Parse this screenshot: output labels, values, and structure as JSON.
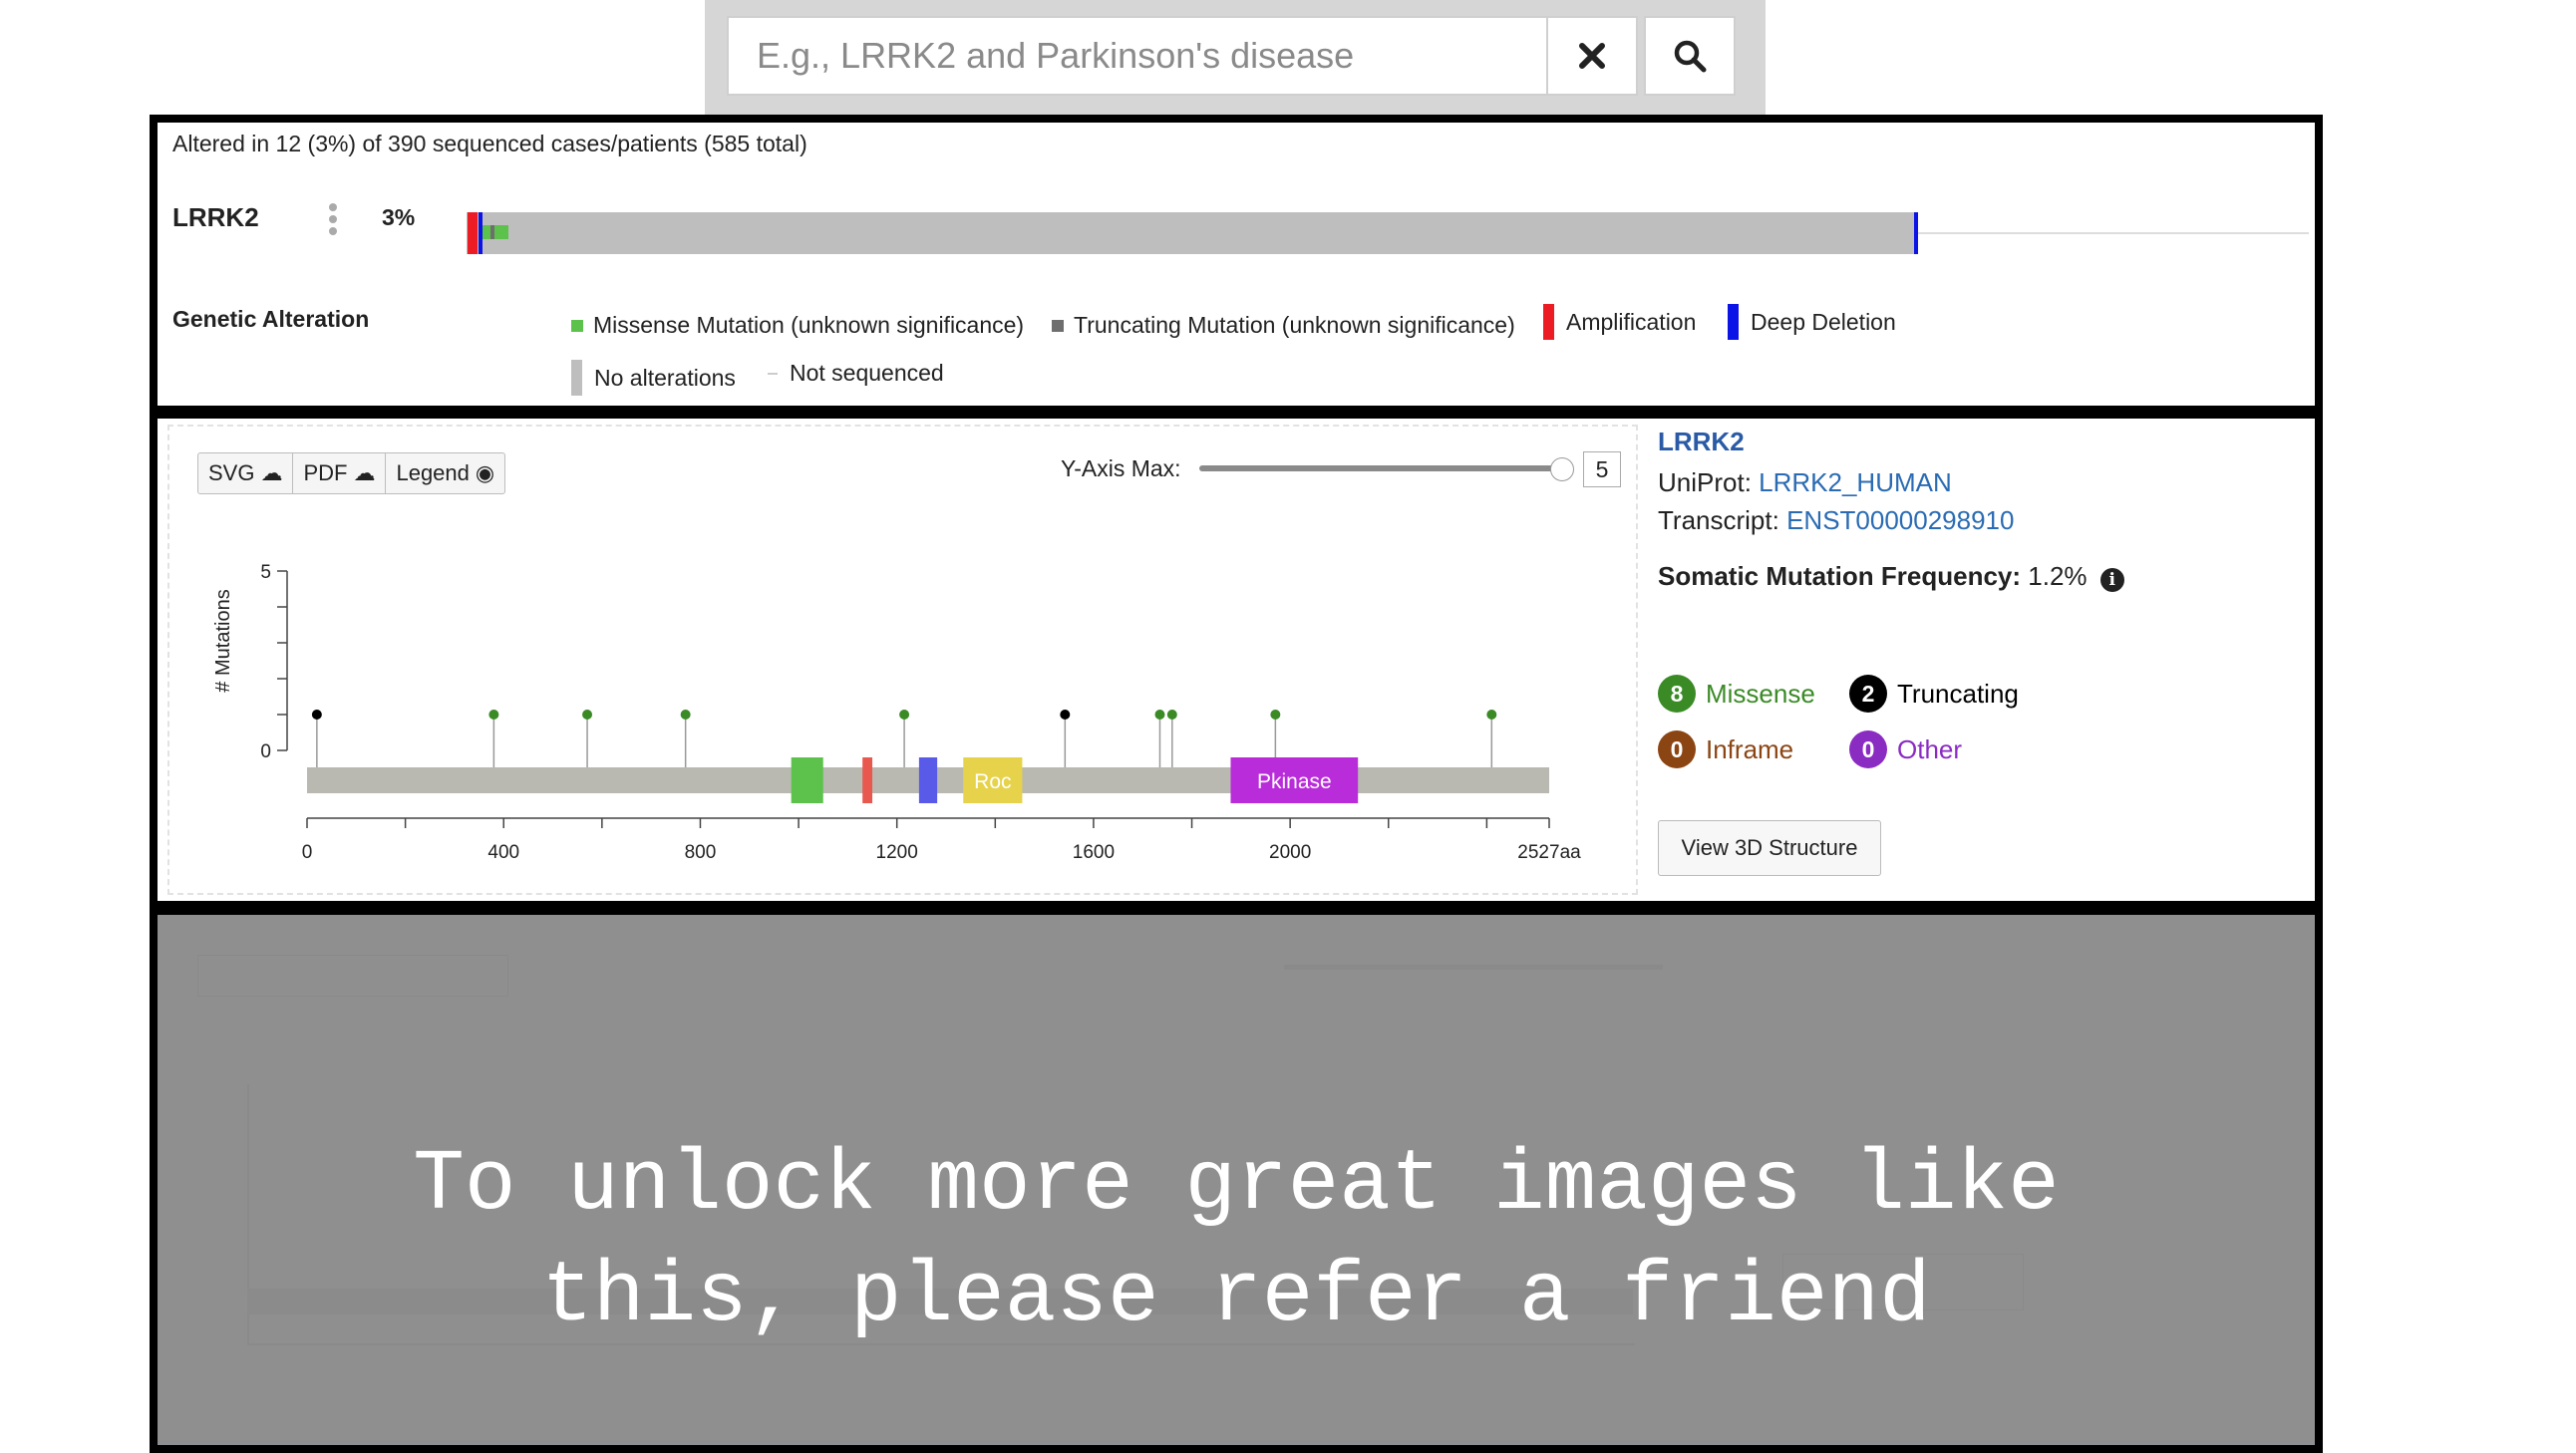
{
  "search": {
    "placeholder": "E.g., LRRK2 and Parkinson's disease",
    "clear_icon": "close-icon",
    "search_icon": "search-icon"
  },
  "oncoprint": {
    "summary": "Altered in 12 (3%) of 390 sequenced cases/patients (585 total)",
    "gene": "LRRK2",
    "percent": "3%",
    "altered_fraction": 0.03,
    "legend_title": "Genetic Alteration",
    "legend": [
      {
        "label": "Missense Mutation (unknown significance)",
        "color": "#5dc24b"
      },
      {
        "label": "Truncating Mutation (unknown significance)",
        "color": "#6e6e6e"
      },
      {
        "label": "Amplification",
        "color": "#ec1c24"
      },
      {
        "label": "Deep Deletion",
        "color": "#0c13e6"
      },
      {
        "label": "No alterations",
        "color": "#bebebe"
      },
      {
        "label": "Not sequenced",
        "color": "#dddddd"
      }
    ]
  },
  "mutation_panel": {
    "buttons": {
      "svg": "SVG",
      "pdf": "PDF",
      "legend": "Legend"
    },
    "y_axis_max_label": "Y-Axis Max:",
    "y_axis_max_value": "5",
    "gene_title": "LRRK2",
    "uniprot_label": "UniProt:",
    "uniprot_id": "LRRK2_HUMAN",
    "transcript_label": "Transcript:",
    "transcript_id": "ENST00000298910",
    "freq_label": "Somatic Mutation Frequency:",
    "freq_value": "1.2%",
    "types": [
      {
        "count": "8",
        "label": "Missense",
        "color": "#3a8a25"
      },
      {
        "count": "2",
        "label": "Truncating",
        "color": "#000000"
      },
      {
        "count": "0",
        "label": "Inframe",
        "color": "#8b4513"
      },
      {
        "count": "0",
        "label": "Other",
        "color": "#8a2bc2"
      }
    ],
    "view_3d_label": "View 3D Structure"
  },
  "chart_data": {
    "type": "lollipop",
    "ylabel": "# Mutations",
    "ylim": [
      0,
      5
    ],
    "yticks": [
      "0",
      "5"
    ],
    "xlim": [
      0,
      2527
    ],
    "xticks": [
      "0",
      "400",
      "800",
      "1200",
      "1600",
      "2000",
      "2527aa"
    ],
    "xtick_values": [
      0,
      400,
      800,
      1200,
      1600,
      2000,
      2527
    ],
    "lollipops": [
      {
        "position": 20,
        "count": 1,
        "type": "Truncating",
        "color": "#000000"
      },
      {
        "position": 380,
        "count": 1,
        "type": "Missense",
        "color": "#3a8a25"
      },
      {
        "position": 570,
        "count": 1,
        "type": "Missense",
        "color": "#3a8a25"
      },
      {
        "position": 770,
        "count": 1,
        "type": "Missense",
        "color": "#3a8a25"
      },
      {
        "position": 1215,
        "count": 1,
        "type": "Missense",
        "color": "#3a8a25"
      },
      {
        "position": 1542,
        "count": 1,
        "type": "Truncating",
        "color": "#000000"
      },
      {
        "position": 1735,
        "count": 1,
        "type": "Missense",
        "color": "#3a8a25"
      },
      {
        "position": 1760,
        "count": 1,
        "type": "Missense",
        "color": "#3a8a25"
      },
      {
        "position": 1970,
        "count": 1,
        "type": "Missense",
        "color": "#3a8a25"
      },
      {
        "position": 2410,
        "count": 1,
        "type": "Missense",
        "color": "#3a8a25"
      }
    ],
    "domains": [
      {
        "start": 985,
        "end": 1050,
        "label": "",
        "color": "#5dc24b"
      },
      {
        "start": 1130,
        "end": 1150,
        "label": "",
        "color": "#e8584f"
      },
      {
        "start": 1245,
        "end": 1282,
        "label": "",
        "color": "#5a5ae8"
      },
      {
        "start": 1335,
        "end": 1455,
        "label": "Roc",
        "color": "#e6d34b"
      },
      {
        "start": 1879,
        "end": 2138,
        "label": "Pkinase",
        "color": "#b92cd9"
      }
    ]
  },
  "locked": {
    "message": "To unlock more great images like\nthis, please refer a friend"
  }
}
